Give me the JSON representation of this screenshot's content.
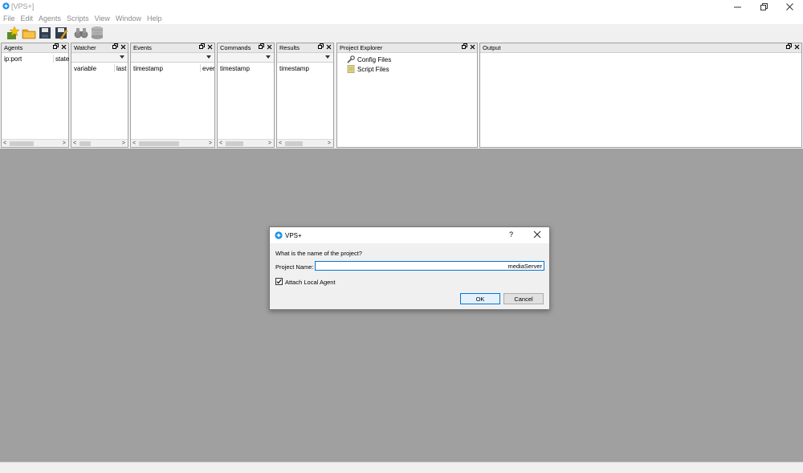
{
  "window": {
    "title": "[VPS+]"
  },
  "menu": [
    "File",
    "Edit",
    "Agents",
    "Scripts",
    "View",
    "Window",
    "Help"
  ],
  "toolbar": {
    "buttons": [
      "new-project-icon",
      "open-folder-icon",
      "save-icon",
      "save-as-icon",
      "binoculars-icon",
      "database-icon"
    ]
  },
  "panels": {
    "agents": {
      "title": "Agents",
      "columns": [
        "ip:port",
        "state"
      ]
    },
    "watcher": {
      "title": "Watcher",
      "columns": [
        "variable",
        "last"
      ]
    },
    "events": {
      "title": "Events",
      "columns": [
        "timestamp",
        "ever"
      ]
    },
    "commands": {
      "title": "Commands",
      "columns": [
        "timestamp"
      ]
    },
    "results": {
      "title": "Results",
      "columns": [
        "timestamp"
      ]
    },
    "project_explorer": {
      "title": "Project Explorer",
      "items": [
        "Config Files",
        "Script Files"
      ]
    },
    "output": {
      "title": "Output"
    }
  },
  "dialog": {
    "title": "VPS+",
    "help": "?",
    "question": "What is the name of the project?",
    "name_label": "Project Name:",
    "name_value": "mediaServer",
    "attach_label": "Attach Local Agent",
    "attach_checked": true,
    "ok_label": "OK",
    "cancel_label": "Cancel"
  },
  "colors": {
    "accent": "#0078d7",
    "mdi_background": "#a0a0a0"
  }
}
